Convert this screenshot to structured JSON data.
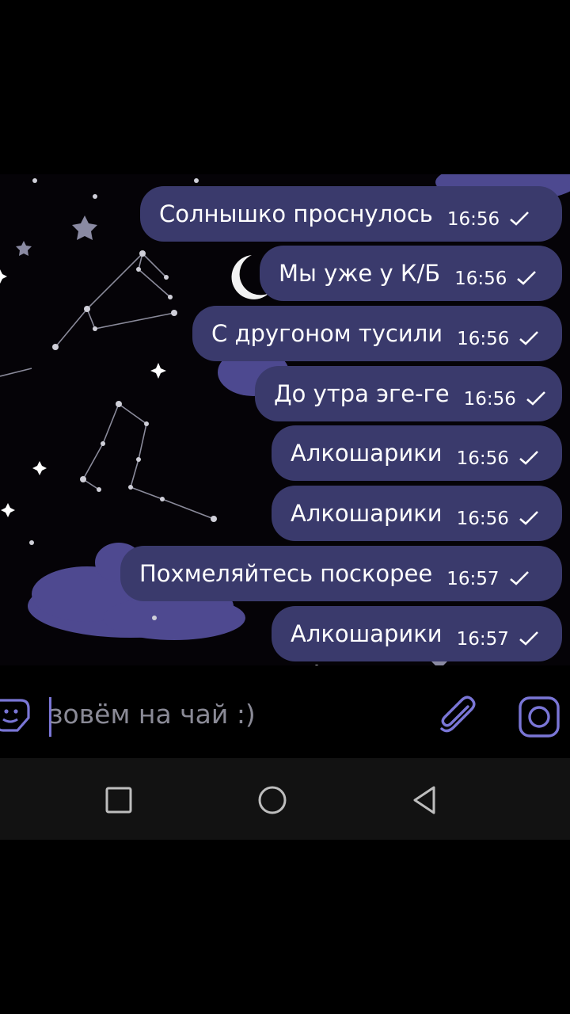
{
  "messages": [
    {
      "text": "Солнышко проснулось",
      "time": "16:56"
    },
    {
      "text": "Мы уже у К/Б",
      "time": "16:56"
    },
    {
      "text": "С другоном тусили",
      "time": "16:56"
    },
    {
      "text": "До утра эге-ге",
      "time": "16:56"
    },
    {
      "text": "Алкошарики",
      "time": "16:56"
    },
    {
      "text": "Алкошарики",
      "time": "16:56"
    },
    {
      "text": "Похмеляйтесь поскорее",
      "time": "16:57"
    },
    {
      "text": "Алкошарики",
      "time": "16:57"
    }
  ],
  "composer": {
    "value": "зовём на чай :)"
  },
  "colors": {
    "bubble": "#3a3a6c",
    "accent": "#7a76d6",
    "background": "#000000"
  },
  "icons": {
    "sticker": "sticker-icon",
    "attach": "paperclip-icon",
    "camera": "camera-icon",
    "nav_recent": "square-icon",
    "nav_home": "circle-icon",
    "nav_back": "triangle-back-icon"
  }
}
